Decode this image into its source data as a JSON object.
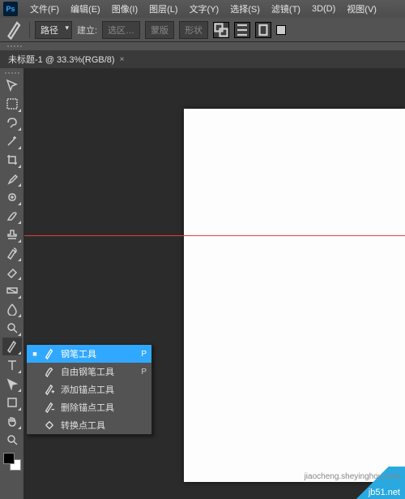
{
  "logo": "Ps",
  "menu": [
    "文件(F)",
    "编辑(E)",
    "图像(I)",
    "图层(L)",
    "文字(Y)",
    "选择(S)",
    "滤镜(T)",
    "3D(D)",
    "视图(V)"
  ],
  "options": {
    "mode": "路径",
    "build_label": "建立:",
    "btn_selection": "选区…",
    "btn_mask": "蒙版",
    "btn_shape": "形状"
  },
  "tab": {
    "title": "未标题-1 @ 33.3%(RGB/8)",
    "close": "×"
  },
  "flyout": [
    {
      "mark": "■",
      "label": "钢笔工具",
      "short": "P",
      "selected": true,
      "icon": "pen"
    },
    {
      "mark": "",
      "label": "自由钢笔工具",
      "short": "P",
      "selected": false,
      "icon": "free-pen"
    },
    {
      "mark": "",
      "label": "添加锚点工具",
      "short": "",
      "selected": false,
      "icon": "add-anchor"
    },
    {
      "mark": "",
      "label": "删除锚点工具",
      "short": "",
      "selected": false,
      "icon": "del-anchor"
    },
    {
      "mark": "",
      "label": "转换点工具",
      "short": "",
      "selected": false,
      "icon": "convert"
    }
  ],
  "tools": [
    {
      "n": "move",
      "sub": false
    },
    {
      "n": "marquee",
      "sub": true
    },
    {
      "n": "lasso",
      "sub": true
    },
    {
      "n": "wand",
      "sub": true
    },
    {
      "n": "crop",
      "sub": true
    },
    {
      "n": "eyedropper",
      "sub": true
    },
    {
      "n": "heal",
      "sub": true
    },
    {
      "n": "brush",
      "sub": true
    },
    {
      "n": "stamp",
      "sub": true
    },
    {
      "n": "history",
      "sub": true
    },
    {
      "n": "eraser",
      "sub": true
    },
    {
      "n": "gradient",
      "sub": true
    },
    {
      "n": "blur",
      "sub": true
    },
    {
      "n": "dodge",
      "sub": true
    },
    {
      "n": "pen",
      "sub": true,
      "active": true
    },
    {
      "n": "type",
      "sub": true
    },
    {
      "n": "path-sel",
      "sub": true
    },
    {
      "n": "shape",
      "sub": true
    },
    {
      "n": "hand",
      "sub": true
    },
    {
      "n": "zoom",
      "sub": false
    }
  ],
  "watermark": {
    "badge": "jb51.net",
    "url": "jiaocheng.sheyinghou.com"
  }
}
